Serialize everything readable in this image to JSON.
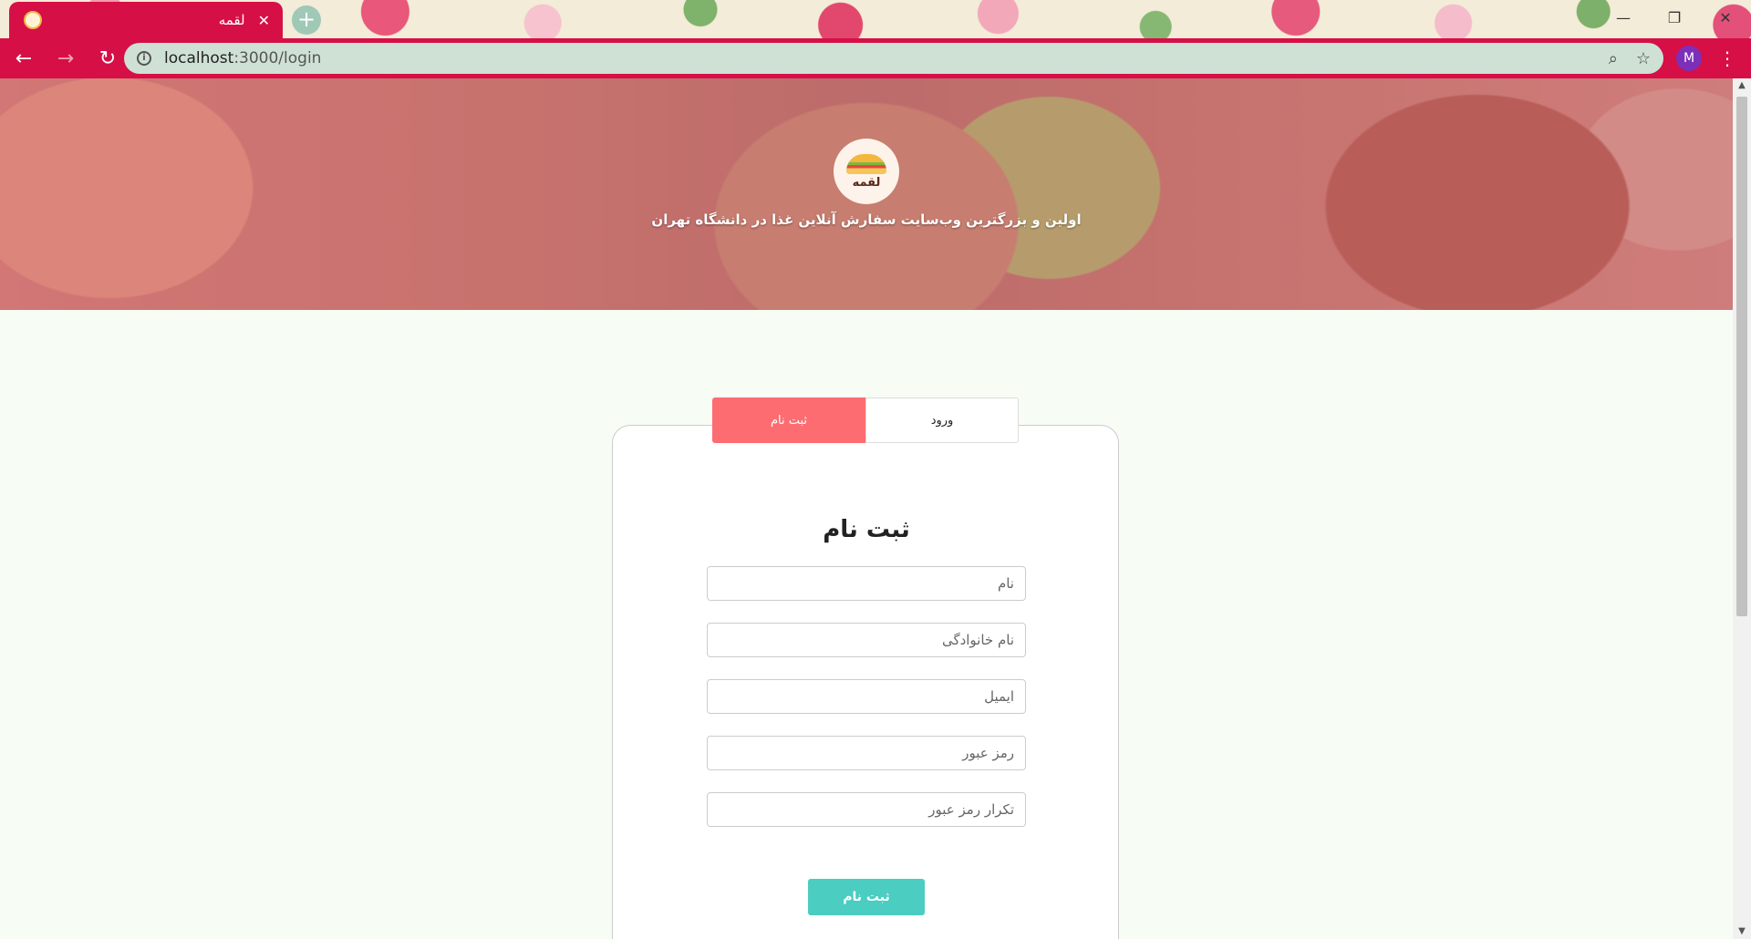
{
  "browser": {
    "tab_title": "لقمه",
    "tab_close": "✕",
    "new_tab": "+",
    "url_host": "localhost",
    "url_rest": ":3000/login",
    "profile_initial": "M",
    "back": "←",
    "forward": "→",
    "reload": "↻",
    "zoom": "⌕",
    "bookmark": "☆",
    "menu": "⋮",
    "minimize": "—",
    "restore": "❐",
    "close": "✕"
  },
  "hero": {
    "logo_text": "لقمه",
    "tagline": "اولین و بزرگترین وب‌سایت سفارش آنلاین غذا در دانشگاه تهران"
  },
  "auth_tabs": {
    "signup": "ثبت نام",
    "login": "ورود",
    "active": "signup"
  },
  "form": {
    "title": "ثبت نام",
    "first_name_placeholder": "نام",
    "last_name_placeholder": "نام خانوادگی",
    "email_placeholder": "ایمیل",
    "password_placeholder": "رمز عبور",
    "confirm_password_placeholder": "تکرار رمز عبور",
    "submit_label": "ثبت نام"
  },
  "colors": {
    "chrome": "#d60f47",
    "active_tab": "#fd6c70",
    "submit": "#4bcdc1",
    "page_bg": "#f7fdf5"
  }
}
